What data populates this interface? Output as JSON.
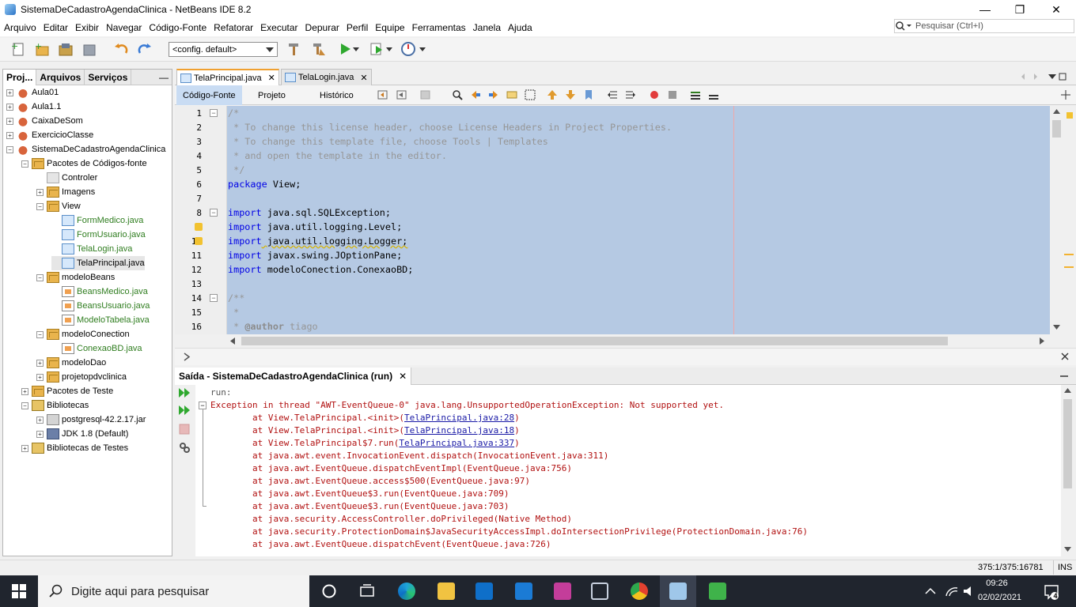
{
  "window": {
    "title": "SistemaDeCadastroAgendaClinica - NetBeans IDE 8.2",
    "controls": [
      "—",
      "❐",
      "✕"
    ]
  },
  "menu": [
    "Arquivo",
    "Editar",
    "Exibir",
    "Navegar",
    "Código-Fonte",
    "Refatorar",
    "Executar",
    "Depurar",
    "Perfil",
    "Equipe",
    "Ferramentas",
    "Janela",
    "Ajuda"
  ],
  "search": {
    "placeholder": "Pesquisar (Ctrl+I)"
  },
  "toolbar": {
    "config_value": "<config. default>"
  },
  "projects_panel": {
    "tabs": [
      "Proj...",
      "Arquivos",
      "Serviços"
    ],
    "minimize": "—",
    "tree": [
      {
        "label": "Aula01",
        "icon": "project-icon",
        "green": false
      },
      {
        "label": "Aula1.1",
        "icon": "project-icon",
        "green": false
      },
      {
        "label": "CaixaDeSom",
        "icon": "project-icon",
        "green": false
      },
      {
        "label": "ExercicioClasse",
        "icon": "project-icon",
        "green": false
      },
      {
        "label": "SistemaDeCadastroAgendaClinica",
        "icon": "project-icon",
        "green": false
      },
      {
        "label": "Pacotes de Códigos-fonte",
        "icon": "source-packages-icon",
        "green": false
      },
      {
        "label": "Controler",
        "icon": "empty-package-icon",
        "green": false
      },
      {
        "label": "Imagens",
        "icon": "package-icon",
        "green": false
      },
      {
        "label": "View",
        "icon": "package-icon",
        "green": false
      },
      {
        "label": "FormMedico.java",
        "icon": "form-icon",
        "green": true
      },
      {
        "label": "FormUsuario.java",
        "icon": "form-icon",
        "green": true
      },
      {
        "label": "TelaLogin.java",
        "icon": "form-icon",
        "green": true
      },
      {
        "label": "TelaPrincipal.java",
        "icon": "form-icon",
        "green": false
      },
      {
        "label": "modeloBeans",
        "icon": "package-icon",
        "green": false
      },
      {
        "label": "BeansMedico.java",
        "icon": "java-file-icon",
        "green": true
      },
      {
        "label": "BeansUsuario.java",
        "icon": "java-file-icon",
        "green": true
      },
      {
        "label": "ModeloTabela.java",
        "icon": "java-file-icon",
        "green": true
      },
      {
        "label": "modeloConection",
        "icon": "package-icon",
        "green": false
      },
      {
        "label": "ConexaoBD.java",
        "icon": "java-file-icon",
        "green": true
      },
      {
        "label": "modeloDao",
        "icon": "package-icon",
        "green": false
      },
      {
        "label": "projetopdvclinica",
        "icon": "package-icon",
        "green": false
      },
      {
        "label": "Pacotes de Teste",
        "icon": "test-packages-icon",
        "green": false
      },
      {
        "label": "Bibliotecas",
        "icon": "library-icon",
        "green": false
      },
      {
        "label": "postgresql-42.2.17.jar",
        "icon": "jar-icon",
        "green": false
      },
      {
        "label": "JDK 1.8 (Default)",
        "icon": "jdk-icon",
        "green": false
      },
      {
        "label": "Bibliotecas de Testes",
        "icon": "library-icon",
        "green": false
      }
    ]
  },
  "editor": {
    "tabs": [
      {
        "label": "TelaPrincipal.java",
        "close": "✕"
      },
      {
        "label": "TelaLogin.java",
        "close": "✕"
      }
    ],
    "subtabs": [
      "Código-Fonte",
      "Projeto",
      "Histórico"
    ],
    "line_numbers": [
      "1",
      "2",
      "3",
      "4",
      "5",
      "6",
      "7",
      "8",
      "9",
      "10",
      "11",
      "12",
      "13",
      "14",
      "15",
      "16"
    ],
    "code": [
      {
        "k": "",
        "t": "/*"
      },
      {
        "k": "",
        "t": " * To change this license header, choose License Headers in Project Properties."
      },
      {
        "k": "",
        "t": " * To change this template file, choose Tools | Templates"
      },
      {
        "k": "",
        "t": " * and open the template in the editor."
      },
      {
        "k": "",
        "t": " */"
      },
      {
        "k": "package",
        "t": " View;"
      },
      {
        "k": "",
        "t": ""
      },
      {
        "k": "import",
        "t": " java.sql.SQLException;"
      },
      {
        "k": "import",
        "t": " java.util.logging.Level;"
      },
      {
        "k": "import",
        "t": " java.util.logging.Logger;"
      },
      {
        "k": "import",
        "t": " javax.swing.JOptionPane;"
      },
      {
        "k": "import",
        "t": " modeloConection.ConexaoBD;"
      },
      {
        "k": "",
        "t": ""
      },
      {
        "k": "",
        "t": "/**"
      },
      {
        "k": "",
        "t": " *"
      },
      {
        "k": "@author",
        "t": " tiago"
      }
    ]
  },
  "output": {
    "title": "Saída - SistemaDeCadastroAgendaClinica (run)",
    "close": "✕",
    "lines": [
      {
        "pre": "run:",
        "link": "",
        "post": "",
        "gray": true
      },
      {
        "pre": "Exception in thread \"AWT-EventQueue-0\" java.lang.UnsupportedOperationException: Not supported yet.",
        "link": "",
        "post": ""
      },
      {
        "pre": "        at View.TelaPrincipal.<init>(",
        "link": "TelaPrincipal.java:28",
        "post": ")"
      },
      {
        "pre": "        at View.TelaPrincipal.<init>(",
        "link": "TelaPrincipal.java:18",
        "post": ")"
      },
      {
        "pre": "        at View.TelaPrincipal$7.run(",
        "link": "TelaPrincipal.java:337",
        "post": ")"
      },
      {
        "pre": "        at java.awt.event.InvocationEvent.dispatch(InvocationEvent.java:311)",
        "link": "",
        "post": ""
      },
      {
        "pre": "        at java.awt.EventQueue.dispatchEventImpl(EventQueue.java:756)",
        "link": "",
        "post": ""
      },
      {
        "pre": "        at java.awt.EventQueue.access$500(EventQueue.java:97)",
        "link": "",
        "post": ""
      },
      {
        "pre": "        at java.awt.EventQueue$3.run(EventQueue.java:709)",
        "link": "",
        "post": ""
      },
      {
        "pre": "        at java.awt.EventQueue$3.run(EventQueue.java:703)",
        "link": "",
        "post": ""
      },
      {
        "pre": "        at java.security.AccessController.doPrivileged(Native Method)",
        "link": "",
        "post": ""
      },
      {
        "pre": "        at java.security.ProtectionDomain$JavaSecurityAccessImpl.doIntersectionPrivilege(ProtectionDomain.java:76)",
        "link": "",
        "post": ""
      },
      {
        "pre": "        at java.awt.EventQueue.dispatchEvent(EventQueue.java:726)",
        "link": "",
        "post": ""
      }
    ]
  },
  "status": {
    "position": "375:1/375:16781",
    "mode": "INS"
  },
  "taskbar": {
    "search_text": "Digite aqui para pesquisar",
    "time": "09:26",
    "date": "02/02/2021",
    "notifications": "4"
  }
}
